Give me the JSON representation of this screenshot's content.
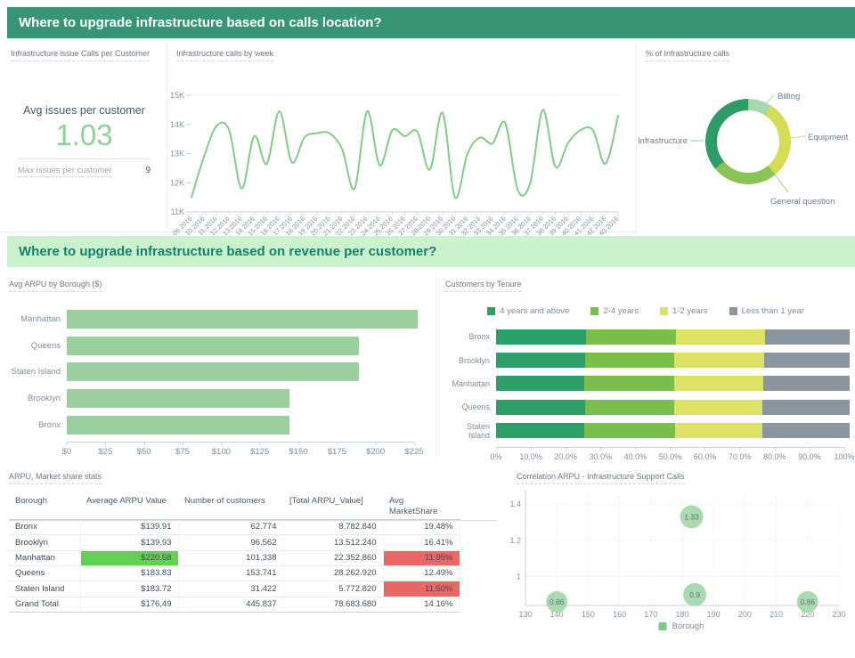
{
  "colors": {
    "header_bg": "#389573",
    "header_text": "#ffffff",
    "section2_bg": "#c9f2cd",
    "section2_text": "#17806d",
    "kpi_value_green": "#8ed29a",
    "line_green": "#85ca89",
    "bar_green": "#9bcf9e",
    "table_highlight_green": "#61d053",
    "table_highlight_red": "#ea6767"
  },
  "section1": {
    "title": "Where to upgrade infrastructure based on calls location?"
  },
  "section2": {
    "title": "Where to upgrade infrastructure based on revenue per customer?"
  },
  "kpi": {
    "panel_title": "Infrastructure issue Calls per Customer",
    "avg_label": "Avg issues per customer",
    "avg_value": "1.03",
    "max_label": "Max issues per customer",
    "max_value": "9"
  },
  "chart_data": [
    {
      "type": "line",
      "title": "Infrastructure calls by week",
      "x": [
        "09.2016",
        "10.2016",
        "11.2016",
        "12.2016",
        "13.2016",
        "14.2016",
        "15.2016",
        "16.2016",
        "17.2016",
        "18.2016",
        "19.2016",
        "20.2016",
        "21.2016",
        "22.2016",
        "23.2016",
        "24.2016",
        "25.2016",
        "26.2016",
        "27.2016",
        "28.2016",
        "29.2016",
        "30.2016",
        "31.2016",
        "32.2016",
        "33.2016",
        "34.2016",
        "35.2016",
        "36.2016",
        "37.2016",
        "38.2016",
        "39.2016",
        "40.2016",
        "41.2016",
        "42.2016",
        "43.2016"
      ],
      "values_thousands": [
        11.5,
        12.9,
        13.95,
        13.8,
        11.8,
        13.6,
        12.65,
        14.45,
        12.7,
        13.55,
        13.7,
        13.7,
        13.15,
        11.8,
        14.45,
        12.6,
        13.8,
        13.6,
        13.75,
        12.45,
        14.4,
        11.5,
        13.0,
        13.55,
        13.35,
        14.05,
        11.75,
        12.0,
        14.5,
        12.55,
        13.35,
        13.8,
        13.8,
        12.65,
        14.3
      ],
      "yticks": [
        "11K",
        "12K",
        "13K",
        "14K",
        "15K"
      ],
      "ylim": [
        11,
        15
      ],
      "xlabel": "",
      "ylabel": "",
      "grid": "top gridline only",
      "line_color": "#85ca89"
    },
    {
      "type": "pie",
      "title": "% of Infrastructure calls",
      "labels": [
        "Billing",
        "Equipment",
        "General question",
        "Infrastructure"
      ],
      "values_pct": [
        9,
        30,
        25,
        36
      ],
      "colors": [
        "#a5d8ad",
        "#d5dc55",
        "#8ac455",
        "#2f9c68"
      ],
      "donut": true
    },
    {
      "type": "bar",
      "orientation": "horizontal",
      "title": "Avg ARPU by Borough ($)",
      "categories": [
        "Manhattan",
        "Queens",
        "Staten Island",
        "Brooklyn",
        "Bronx"
      ],
      "values": [
        220.58,
        183.83,
        183.72,
        139.93,
        139.91
      ],
      "xticks": [
        "$0",
        "$25",
        "$50",
        "$75",
        "$100",
        "$125",
        "$150",
        "$175",
        "$200",
        "$225"
      ],
      "xlim": [
        0,
        225
      ],
      "bar_color": "#9bcf9e"
    },
    {
      "type": "bar",
      "orientation": "stacked-horizontal",
      "title": "Customers by Tenure",
      "categories": [
        "Bronx",
        "Brooklyn",
        "Manhattan",
        "Queens",
        "Staten Island"
      ],
      "series": [
        {
          "name": "4 years and above",
          "color": "#2d9e68",
          "values": [
            25.4,
            25.1,
            24.9,
            25.2,
            25.0
          ]
        },
        {
          "name": "2-4 years",
          "color": "#7abf4c",
          "values": [
            25.6,
            25.3,
            25.4,
            25.1,
            25.6
          ]
        },
        {
          "name": "1-2 years",
          "color": "#dde266",
          "values": [
            25.2,
            25.3,
            25.2,
            24.9,
            24.7
          ]
        },
        {
          "name": "Less than 1 year",
          "color": "#8a959e",
          "values": [
            23.8,
            24.3,
            24.5,
            24.8,
            24.7
          ]
        }
      ],
      "xticks": [
        "0%",
        "10.0%",
        "20.0%",
        "30.0%",
        "40.0%",
        "50.0%",
        "60.0%",
        "70.0%",
        "80.0%",
        "90.0%",
        "100%"
      ],
      "xlim": [
        0,
        100
      ],
      "legend_position": "top"
    },
    {
      "type": "table",
      "title": "ARPU, Market share stats",
      "columns": [
        "Borough",
        "Average ARPU Value",
        "Number of customers",
        "[Total ARPU_Value]",
        "Avg MarketShare"
      ],
      "rows": [
        [
          "Bronx",
          "$139.91",
          "62.774",
          "8.782.840",
          "19.48%"
        ],
        [
          "Brooklyn",
          "$139.93",
          "96.562",
          "13.512.240",
          "16.41%"
        ],
        [
          "Manhattan",
          "$220.58",
          "101.338",
          "22.352.860",
          "11.95%"
        ],
        [
          "Queens",
          "$183.83",
          "153.741",
          "28.262.920",
          "12.49%"
        ],
        [
          "Staten Island",
          "$183.72",
          "31.422",
          "5.772.820",
          "11.50%"
        ],
        [
          "Grand Total",
          "$176,49",
          "445.837",
          "78.683.680",
          "14.16%"
        ]
      ],
      "cell_highlights": [
        {
          "row": 2,
          "col": 1,
          "color": "#61d053"
        },
        {
          "row": 2,
          "col": 4,
          "color": "#ea6767"
        },
        {
          "row": 4,
          "col": 4,
          "color": "#ea6767"
        }
      ]
    },
    {
      "type": "scatter",
      "title": "Correlation ARPU - Infrastructure Support Calls",
      "points": [
        {
          "x": 140,
          "y": 0.86,
          "label": "0.86",
          "r": 12
        },
        {
          "x": 183,
          "y": 1.33,
          "label": "1.33",
          "r": 13
        },
        {
          "x": 184,
          "y": 0.9,
          "label": "0.9",
          "r": 13
        },
        {
          "x": 220,
          "y": 0.86,
          "label": "0.86",
          "r": 12
        }
      ],
      "xticks": [
        "130",
        "140",
        "150",
        "160",
        "170",
        "180",
        "190",
        "200",
        "210",
        "220",
        "230"
      ],
      "xlim": [
        130,
        230
      ],
      "yticks": [
        "1",
        "1.2",
        "1.4"
      ],
      "ylim": [
        0.84,
        1.44
      ],
      "legend": "Borough",
      "bubble_color": "#a3d6a7",
      "grid": "dotted"
    }
  ]
}
